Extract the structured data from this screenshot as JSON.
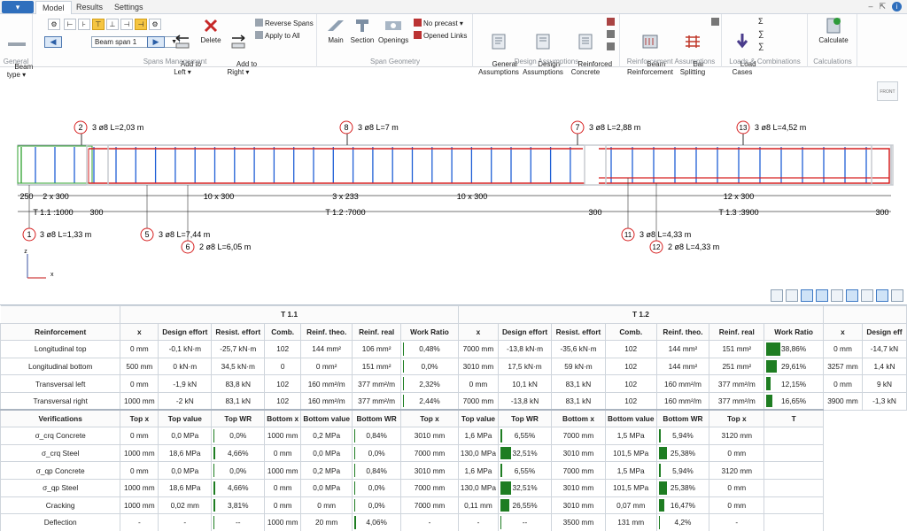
{
  "app": {
    "menu_label": "▾"
  },
  "tabs": [
    "Model",
    "Results",
    "Settings"
  ],
  "ribbon": {
    "general": {
      "title": "General",
      "beam_type": "Beam\ntype ▾"
    },
    "spans": {
      "title": "Spans Management",
      "selected_span": "Beam span 1",
      "add_left": "Add to\nLeft ▾",
      "delete": "Delete",
      "add_right": "Add to\nRight ▾",
      "reverse": "Reverse Spans",
      "apply_all": "Apply to All"
    },
    "geometry": {
      "title": "Span Geometry",
      "main": "Main",
      "section": "Section",
      "openings": "Openings",
      "no_precast": "No precast ▾",
      "opened_links": "Opened Links"
    },
    "design": {
      "title": "Design Assumptions",
      "general": "General\nAssumptions",
      "design": "Design\nAssumptions",
      "concrete": "Reinforced\nConcrete"
    },
    "reinf": {
      "title": "Reinforcement Assumptions",
      "beam": "Beam\nReinforcement",
      "bar": "Bar\nSplitting"
    },
    "loads": {
      "title": "Loads & Combinations",
      "cases": "Load\nCases"
    },
    "calc": {
      "title": "Calculations",
      "calculate": "Calculate"
    },
    "front": "FRONT"
  },
  "drawing": {
    "bar_labels": [
      {
        "num": "2",
        "text": "3 ø8 L=2,03 m"
      },
      {
        "num": "8",
        "text": "3 ø8 L=7 m"
      },
      {
        "num": "7",
        "text": "3 ø8 L=2,88 m"
      },
      {
        "num": "13",
        "text": "3 ø8 L=4,52 m"
      },
      {
        "num": "1",
        "text": "3 ø8 L=1,33 m"
      },
      {
        "num": "5",
        "text": "3 ø8 L=7,44 m"
      },
      {
        "num": "6",
        "text": "2 ø8 L=6,05 m"
      },
      {
        "num": "11",
        "text": "3 ø8 L=4,33 m"
      },
      {
        "num": "12",
        "text": "2 ø8 L=4,33 m"
      }
    ],
    "dims_top": [
      "250",
      "2 x 300",
      "10 x 300",
      "3 x 233",
      "10 x 300",
      "12 x 300"
    ],
    "dims_bottom": [
      "T 1.1 :1000",
      "300",
      "T 1.2 :7000",
      "300",
      "T 1.3 :3900",
      "300"
    ],
    "axis": {
      "z": "z",
      "x": "x"
    }
  },
  "table": {
    "span_headers": [
      "T 1.1",
      "T 1.2"
    ],
    "reinf_head": [
      "Reinforcement",
      "x",
      "Design effort",
      "Resist. effort",
      "Comb.",
      "Reinf. theo.",
      "Reinf. real",
      "Work Ratio",
      "x",
      "Design effort",
      "Resist. effort",
      "Comb.",
      "Reinf. theo.",
      "Reinf. real",
      "Work Ratio",
      "x",
      "Design eff"
    ],
    "reinf_rows": [
      {
        "name": "Longitudinal top",
        "t11": [
          "0 mm",
          "-0,1 kN·m",
          "-25,7 kN·m",
          "102",
          "144 mm²",
          "106 mm²"
        ],
        "wr11": "0,48%",
        "wr11v": 0.48,
        "t12": [
          "7000 mm",
          "-13,8 kN·m",
          "-35,6 kN·m",
          "102",
          "144 mm²",
          "151 mm²"
        ],
        "wr12": "38,86%",
        "wr12v": 38.86,
        "t13": [
          "0 mm",
          "-14,7 kN"
        ]
      },
      {
        "name": "Longitudinal bottom",
        "t11": [
          "500 mm",
          "0 kN·m",
          "34,5 kN·m",
          "0",
          "0 mm²",
          "151 mm²"
        ],
        "wr11": "0,0%",
        "wr11v": 0,
        "t12": [
          "3010 mm",
          "17,5 kN·m",
          "59 kN·m",
          "102",
          "144 mm²",
          "251 mm²"
        ],
        "wr12": "29,61%",
        "wr12v": 29.61,
        "t13": [
          "3257 mm",
          "1,4 kN"
        ]
      },
      {
        "name": "Transversal left",
        "t11": [
          "0 mm",
          "-1,9 kN",
          "83,8 kN",
          "102",
          "160 mm²/m",
          "377 mm²/m"
        ],
        "wr11": "2,32%",
        "wr11v": 2.32,
        "t12": [
          "0 mm",
          "10,1 kN",
          "83,1 kN",
          "102",
          "160 mm²/m",
          "377 mm²/m"
        ],
        "wr12": "12,15%",
        "wr12v": 12.15,
        "t13": [
          "0 mm",
          "9 kN"
        ]
      },
      {
        "name": "Transversal right",
        "t11": [
          "1000 mm",
          "-2 kN",
          "83,1 kN",
          "102",
          "160 mm²/m",
          "377 mm²/m"
        ],
        "wr11": "2,44%",
        "wr11v": 2.44,
        "t12": [
          "7000 mm",
          "-13,8 kN",
          "83,1 kN",
          "102",
          "160 mm²/m",
          "377 mm²/m"
        ],
        "wr12": "16,65%",
        "wr12v": 16.65,
        "t13": [
          "3900 mm",
          "-1,3 kN"
        ]
      }
    ],
    "verif_head": [
      "Verifications",
      "Top x",
      "Top value",
      "Top WR",
      "Bottom x",
      "Bottom value",
      "Bottom WR",
      "Top x",
      "Top value",
      "Top WR",
      "Bottom x",
      "Bottom value",
      "Bottom WR",
      "Top x",
      "T"
    ],
    "verif_rows": [
      {
        "name": "σ_crq Concrete",
        "a": [
          "0 mm",
          "0,0 MPa"
        ],
        "awr": "0,0%",
        "awrv": 0,
        "b": [
          "1000 mm",
          "0,2 MPa"
        ],
        "bwr": "0,84%",
        "bwrv": 0.84,
        "c": [
          "3010 mm",
          "1,6 MPa"
        ],
        "cwr": "6,55%",
        "cwrv": 6.55,
        "d": [
          "7000 mm",
          "1,5 MPa"
        ],
        "dwr": "5,94%",
        "dwrv": 5.94,
        "e": "3120 mm"
      },
      {
        "name": "σ_crq Steel",
        "a": [
          "1000 mm",
          "18,6 MPa"
        ],
        "awr": "4,66%",
        "awrv": 4.66,
        "b": [
          "0 mm",
          "0,0 MPa"
        ],
        "bwr": "0,0%",
        "bwrv": 0,
        "c": [
          "7000 mm",
          "130,0 MPa"
        ],
        "cwr": "32,51%",
        "cwrv": 32.51,
        "d": [
          "3010 mm",
          "101,5 MPa"
        ],
        "dwr": "25,38%",
        "dwrv": 25.38,
        "e": "0 mm"
      },
      {
        "name": "σ_qp Concrete",
        "a": [
          "0 mm",
          "0,0 MPa"
        ],
        "awr": "0,0%",
        "awrv": 0,
        "b": [
          "1000 mm",
          "0,2 MPa"
        ],
        "bwr": "0,84%",
        "bwrv": 0.84,
        "c": [
          "3010 mm",
          "1,6 MPa"
        ],
        "cwr": "6,55%",
        "cwrv": 6.55,
        "d": [
          "7000 mm",
          "1,5 MPa"
        ],
        "dwr": "5,94%",
        "dwrv": 5.94,
        "e": "3120 mm"
      },
      {
        "name": "σ_qp Steel",
        "a": [
          "1000 mm",
          "18,6 MPa"
        ],
        "awr": "4,66%",
        "awrv": 4.66,
        "b": [
          "0 mm",
          "0,0 MPa"
        ],
        "bwr": "0,0%",
        "bwrv": 0,
        "c": [
          "7000 mm",
          "130,0 MPa"
        ],
        "cwr": "32,51%",
        "cwrv": 32.51,
        "d": [
          "3010 mm",
          "101,5 MPa"
        ],
        "dwr": "25,38%",
        "dwrv": 25.38,
        "e": "0 mm"
      },
      {
        "name": "Cracking",
        "a": [
          "1000 mm",
          "0,02 mm"
        ],
        "awr": "3,81%",
        "awrv": 3.81,
        "b": [
          "0 mm",
          "0 mm"
        ],
        "bwr": "0,0%",
        "bwrv": 0,
        "c": [
          "7000 mm",
          "0,11 mm"
        ],
        "cwr": "26,55%",
        "cwrv": 26.55,
        "d": [
          "3010 mm",
          "0,07 mm"
        ],
        "dwr": "16,47%",
        "dwrv": 16.47,
        "e": "0 mm"
      },
      {
        "name": "Deflection",
        "a": [
          "-",
          "-"
        ],
        "awr": "--",
        "awrv": 0,
        "b": [
          "1000 mm",
          "20 mm"
        ],
        "bwr": "4,06%",
        "bwrv": 4.06,
        "c": [
          "-",
          "-"
        ],
        "cwr": "--",
        "cwrv": 0,
        "d": [
          "3500 mm",
          "131 mm"
        ],
        "dwr": "4,2%",
        "dwrv": 4.2,
        "e": "-"
      }
    ]
  },
  "colors": {
    "accent": "#2f6fbd",
    "wr_bar": "#1e7d22",
    "beam_outline": "#d62020",
    "stirrup": "#1f5fd6"
  }
}
